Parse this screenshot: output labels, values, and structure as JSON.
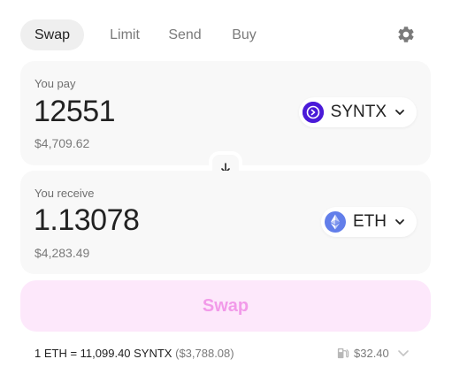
{
  "tabs": [
    {
      "label": "Swap",
      "active": true
    },
    {
      "label": "Limit",
      "active": false
    },
    {
      "label": "Send",
      "active": false
    },
    {
      "label": "Buy",
      "active": false
    }
  ],
  "pay": {
    "label": "You pay",
    "amount": "12551",
    "fiat": "$4,709.62",
    "token": {
      "symbol": "SYNTX",
      "icon": "syntx-token-icon",
      "color": "#4a1ad8"
    }
  },
  "receive": {
    "label": "You receive",
    "amount": "1.13078",
    "fiat": "$4,283.49",
    "token": {
      "symbol": "ETH",
      "icon": "eth-token-icon",
      "color": "#627eea"
    }
  },
  "swap_button": {
    "label": "Swap",
    "text_color": "#f29ae9",
    "bg_color": "#fde8fb"
  },
  "footer": {
    "rate": "1 ETH = 11,099.40 SYNTX",
    "rate_usd": "($3,788.08)",
    "gas": "$32.40"
  }
}
